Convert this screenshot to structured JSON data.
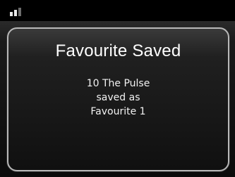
{
  "status_bar": {
    "signal_icon": "signal-strength-icon",
    "signal_level": 2,
    "signal_max": 3
  },
  "dialog": {
    "title": "Favourite Saved",
    "lines": [
      "10 The Pulse",
      "saved as",
      "Favourite 1"
    ]
  },
  "colors": {
    "background": "#000000",
    "dialog_border": "#b9b9b9",
    "text": "#ffffff"
  }
}
